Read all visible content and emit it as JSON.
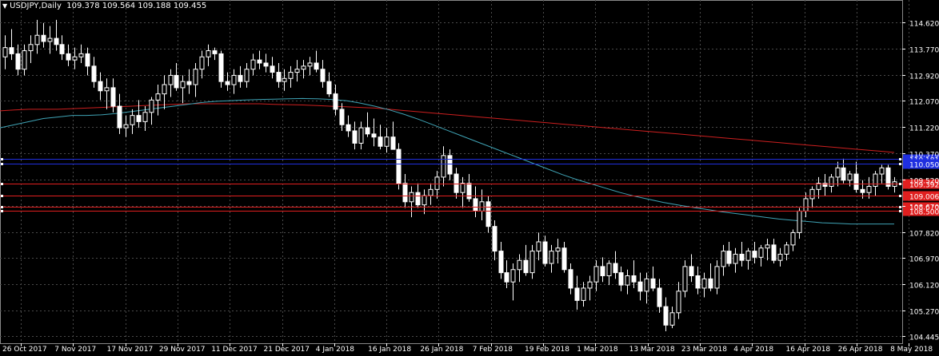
{
  "window": {
    "symbol_timeframe": "USDJPY,Daily",
    "ohlc": "109.378 109.564 109.188 109.455"
  },
  "colors": {
    "background": "#000000",
    "grid": "#4a4a4a",
    "bull_candle": "#000000",
    "bear_candle": "#ffffff",
    "wick": "#ffffff",
    "ma_slow": "#cc1f1f",
    "ma_fast": "#3fa3b5",
    "level_blue": "#1f2fe0",
    "level_red": "#e01f1f",
    "axis_text": "#ffffff"
  },
  "chart_data": {
    "type": "candlestick",
    "title": "",
    "ylim": [
      104.2,
      115.2
    ],
    "y_ticks": [
      "114.620",
      "113.770",
      "112.920",
      "112.070",
      "111.220",
      "110.370",
      "109.520",
      "108.670",
      "107.820",
      "106.970",
      "106.120",
      "105.270",
      "104.445"
    ],
    "x_ticks": [
      "26 Oct 2017",
      "7 Nov 2017",
      "17 Nov 2017",
      "29 Nov 2017",
      "11 Dec 2017",
      "21 Dec 2017",
      "4 Jan 2018",
      "16 Jan 2018",
      "26 Jan 2018",
      "7 Feb 2018",
      "19 Feb 2018",
      "1 Mar 2018",
      "13 Mar 2018",
      "23 Mar 2018",
      "4 Apr 2018",
      "16 Apr 2018",
      "26 Apr 2018",
      "8 May 2018"
    ],
    "levels": [
      {
        "color": "blue",
        "price": 110.181
      },
      {
        "color": "blue",
        "price": 110.05
      },
      {
        "color": "red",
        "price": 109.392
      },
      {
        "color": "red",
        "price": 109.006
      },
      {
        "color": "red",
        "price": 108.64
      },
      {
        "color": "red",
        "price": 108.5
      }
    ],
    "level_labels": [
      "110.181",
      "110.050",
      "109.392",
      "109.006",
      "108.640",
      "108.500"
    ],
    "candles": [
      [
        113.5,
        114.2,
        113.1,
        113.8
      ],
      [
        113.8,
        114.4,
        113.4,
        113.6
      ],
      [
        113.6,
        113.9,
        112.9,
        113.1
      ],
      [
        113.1,
        113.9,
        112.9,
        113.7
      ],
      [
        113.7,
        114.2,
        113.3,
        113.9
      ],
      [
        113.9,
        114.7,
        113.6,
        114.2
      ],
      [
        114.2,
        114.6,
        113.8,
        114.0
      ],
      [
        114.0,
        114.5,
        113.6,
        114.1
      ],
      [
        114.1,
        114.7,
        113.7,
        113.9
      ],
      [
        113.9,
        114.2,
        113.4,
        113.6
      ],
      [
        113.6,
        113.9,
        113.2,
        113.4
      ],
      [
        113.4,
        113.8,
        113.1,
        113.5
      ],
      [
        113.5,
        113.9,
        113.3,
        113.6
      ],
      [
        113.6,
        113.8,
        112.9,
        113.2
      ],
      [
        113.2,
        113.5,
        112.5,
        112.7
      ],
      [
        112.7,
        113.0,
        112.1,
        112.4
      ],
      [
        112.4,
        112.8,
        111.8,
        112.5
      ],
      [
        112.5,
        112.8,
        111.7,
        111.9
      ],
      [
        111.9,
        112.3,
        111.0,
        111.2
      ],
      [
        111.2,
        111.6,
        110.9,
        111.3
      ],
      [
        111.3,
        111.8,
        111.0,
        111.6
      ],
      [
        111.6,
        112.1,
        111.2,
        111.4
      ],
      [
        111.4,
        111.9,
        111.1,
        111.7
      ],
      [
        111.7,
        112.2,
        111.3,
        112.1
      ],
      [
        112.1,
        112.6,
        111.6,
        112.3
      ],
      [
        112.3,
        112.9,
        111.8,
        112.6
      ],
      [
        112.6,
        113.1,
        112.2,
        112.9
      ],
      [
        112.9,
        113.3,
        112.4,
        112.5
      ],
      [
        112.5,
        112.9,
        112.0,
        112.7
      ],
      [
        112.7,
        113.1,
        112.3,
        112.6
      ],
      [
        112.6,
        113.3,
        112.2,
        113.1
      ],
      [
        113.1,
        113.7,
        112.8,
        113.5
      ],
      [
        113.5,
        113.9,
        113.2,
        113.7
      ],
      [
        113.7,
        113.8,
        113.4,
        113.6
      ],
      [
        113.6,
        113.7,
        112.5,
        112.7
      ],
      [
        112.7,
        113.0,
        112.4,
        112.6
      ],
      [
        112.6,
        113.1,
        112.3,
        112.9
      ],
      [
        112.9,
        113.2,
        112.5,
        112.7
      ],
      [
        112.7,
        113.3,
        112.5,
        113.1
      ],
      [
        113.1,
        113.6,
        112.9,
        113.4
      ],
      [
        113.4,
        113.7,
        113.1,
        113.3
      ],
      [
        113.3,
        113.6,
        113.0,
        113.2
      ],
      [
        113.2,
        113.5,
        112.8,
        113.0
      ],
      [
        113.0,
        113.3,
        112.5,
        112.7
      ],
      [
        112.7,
        113.1,
        112.4,
        112.8
      ],
      [
        112.8,
        113.2,
        112.5,
        113.0
      ],
      [
        113.0,
        113.4,
        112.7,
        113.1
      ],
      [
        113.1,
        113.4,
        112.8,
        113.2
      ],
      [
        113.2,
        113.5,
        112.9,
        113.3
      ],
      [
        113.3,
        113.7,
        113.0,
        113.1
      ],
      [
        113.1,
        113.4,
        112.5,
        112.7
      ],
      [
        112.7,
        113.0,
        112.2,
        112.3
      ],
      [
        112.3,
        112.6,
        111.6,
        111.8
      ],
      [
        111.8,
        112.0,
        111.1,
        111.3
      ],
      [
        111.3,
        111.6,
        110.9,
        111.1
      ],
      [
        111.1,
        111.4,
        110.5,
        110.7
      ],
      [
        110.7,
        111.4,
        110.5,
        111.2
      ],
      [
        111.2,
        111.7,
        110.9,
        111.0
      ],
      [
        111.0,
        111.5,
        110.6,
        110.9
      ],
      [
        110.9,
        111.3,
        110.5,
        110.6
      ],
      [
        110.6,
        111.2,
        110.4,
        110.9
      ],
      [
        110.9,
        111.4,
        110.6,
        110.5
      ],
      [
        110.5,
        110.7,
        109.2,
        109.4
      ],
      [
        109.4,
        109.7,
        108.6,
        108.8
      ],
      [
        108.8,
        109.3,
        108.3,
        109.1
      ],
      [
        109.1,
        109.4,
        108.6,
        108.7
      ],
      [
        108.7,
        109.2,
        108.4,
        109.0
      ],
      [
        109.0,
        109.4,
        108.7,
        109.2
      ],
      [
        109.2,
        109.8,
        108.9,
        109.6
      ],
      [
        109.6,
        110.6,
        109.3,
        110.3
      ],
      [
        110.3,
        110.5,
        109.5,
        109.7
      ],
      [
        109.7,
        109.9,
        108.9,
        109.1
      ],
      [
        109.1,
        109.6,
        108.6,
        109.4
      ],
      [
        109.4,
        109.7,
        108.8,
        108.9
      ],
      [
        108.9,
        109.3,
        108.3,
        108.5
      ],
      [
        108.5,
        109.2,
        108.2,
        108.8
      ],
      [
        108.8,
        109.0,
        107.8,
        108.0
      ],
      [
        108.0,
        108.2,
        106.9,
        107.2
      ],
      [
        107.2,
        107.5,
        106.3,
        106.5
      ],
      [
        106.5,
        106.9,
        106.0,
        106.2
      ],
      [
        106.2,
        106.8,
        105.6,
        106.6
      ],
      [
        106.6,
        107.1,
        106.2,
        106.9
      ],
      [
        106.9,
        107.4,
        106.4,
        106.5
      ],
      [
        106.5,
        107.4,
        106.3,
        107.2
      ],
      [
        107.2,
        107.8,
        106.9,
        107.5
      ],
      [
        107.5,
        107.7,
        106.7,
        106.8
      ],
      [
        106.8,
        107.4,
        106.5,
        107.2
      ],
      [
        107.2,
        107.6,
        106.8,
        107.3
      ],
      [
        107.3,
        107.5,
        106.5,
        106.6
      ],
      [
        106.6,
        106.8,
        105.8,
        106.0
      ],
      [
        106.0,
        106.4,
        105.3,
        105.6
      ],
      [
        105.6,
        106.2,
        105.4,
        106.0
      ],
      [
        106.0,
        106.4,
        105.6,
        106.2
      ],
      [
        106.2,
        106.9,
        105.9,
        106.7
      ],
      [
        106.7,
        107.0,
        106.2,
        106.4
      ],
      [
        106.4,
        106.9,
        106.1,
        106.8
      ],
      [
        106.8,
        107.2,
        106.3,
        106.5
      ],
      [
        106.5,
        106.7,
        105.9,
        106.1
      ],
      [
        106.1,
        106.6,
        105.8,
        106.4
      ],
      [
        106.4,
        106.9,
        106.0,
        106.2
      ],
      [
        106.2,
        106.5,
        105.6,
        105.9
      ],
      [
        105.9,
        106.5,
        105.5,
        106.3
      ],
      [
        106.3,
        106.7,
        105.9,
        106.0
      ],
      [
        106.0,
        106.3,
        105.2,
        105.4
      ],
      [
        105.4,
        105.7,
        104.6,
        104.8
      ],
      [
        104.8,
        105.4,
        104.7,
        105.2
      ],
      [
        105.2,
        106.2,
        105.0,
        105.9
      ],
      [
        105.9,
        106.9,
        105.7,
        106.7
      ],
      [
        106.7,
        107.1,
        106.2,
        106.4
      ],
      [
        106.4,
        106.7,
        105.8,
        106.0
      ],
      [
        106.0,
        106.5,
        105.7,
        106.3
      ],
      [
        106.3,
        106.8,
        105.9,
        106.0
      ],
      [
        106.0,
        106.9,
        105.8,
        106.7
      ],
      [
        106.7,
        107.4,
        106.4,
        107.2
      ],
      [
        107.2,
        107.5,
        106.7,
        106.8
      ],
      [
        106.8,
        107.3,
        106.5,
        107.1
      ],
      [
        107.1,
        107.5,
        106.7,
        106.9
      ],
      [
        106.9,
        107.3,
        106.6,
        107.2
      ],
      [
        107.2,
        107.5,
        106.8,
        107.0
      ],
      [
        107.0,
        107.4,
        106.7,
        107.3
      ],
      [
        107.3,
        107.6,
        106.9,
        107.4
      ],
      [
        107.4,
        107.6,
        106.8,
        106.9
      ],
      [
        106.9,
        107.3,
        106.7,
        107.1
      ],
      [
        107.1,
        107.5,
        106.9,
        107.4
      ],
      [
        107.4,
        107.9,
        107.2,
        107.8
      ],
      [
        107.8,
        108.6,
        107.6,
        108.5
      ],
      [
        108.5,
        109.1,
        108.3,
        108.9
      ],
      [
        108.9,
        109.3,
        108.6,
        109.2
      ],
      [
        109.2,
        109.6,
        108.9,
        109.4
      ],
      [
        109.4,
        109.7,
        109.0,
        109.3
      ],
      [
        109.3,
        109.7,
        109.1,
        109.6
      ],
      [
        109.6,
        110.1,
        109.3,
        109.9
      ],
      [
        109.9,
        110.2,
        109.4,
        109.5
      ],
      [
        109.5,
        109.8,
        109.3,
        109.7
      ],
      [
        109.7,
        110.1,
        109.1,
        109.2
      ],
      [
        109.2,
        109.5,
        108.9,
        109.1
      ],
      [
        109.1,
        109.6,
        108.9,
        109.3
      ],
      [
        109.3,
        109.8,
        109.0,
        109.7
      ],
      [
        109.7,
        110.0,
        109.4,
        109.9
      ],
      [
        109.9,
        110.0,
        109.2,
        109.3
      ],
      [
        109.3,
        109.6,
        109.1,
        109.45
      ]
    ],
    "ma_slow": [
      111.75,
      111.78,
      111.8,
      111.8,
      111.8,
      111.82,
      111.84,
      111.86,
      111.88,
      111.9,
      111.92,
      111.94,
      111.96,
      111.98,
      111.98,
      111.98,
      111.98,
      111.98,
      111.98,
      111.96,
      111.95,
      111.94,
      111.92,
      111.9,
      111.88,
      111.86,
      111.84,
      111.8,
      111.76,
      111.72,
      111.68,
      111.64,
      111.6,
      111.56,
      111.52,
      111.48,
      111.44,
      111.4,
      111.36,
      111.32,
      111.28,
      111.24,
      111.2,
      111.16,
      111.12,
      111.08,
      111.04,
      111.0,
      110.96,
      110.92,
      110.88,
      110.84,
      110.8,
      110.76,
      110.72,
      110.68,
      110.64,
      110.6,
      110.56,
      110.52,
      110.48,
      110.44,
      110.4
    ],
    "ma_fast": [
      111.2,
      111.3,
      111.4,
      111.5,
      111.55,
      111.6,
      111.6,
      111.62,
      111.66,
      111.72,
      111.78,
      111.84,
      111.9,
      111.96,
      112.02,
      112.06,
      112.08,
      112.1,
      112.12,
      112.13,
      112.14,
      112.15,
      112.14,
      112.12,
      112.08,
      112.0,
      111.9,
      111.78,
      111.64,
      111.48,
      111.3,
      111.12,
      110.94,
      110.76,
      110.58,
      110.4,
      110.22,
      110.04,
      109.86,
      109.68,
      109.52,
      109.38,
      109.24,
      109.1,
      108.98,
      108.88,
      108.78,
      108.7,
      108.62,
      108.55,
      108.48,
      108.42,
      108.36,
      108.3,
      108.24,
      108.2,
      108.16,
      108.12,
      108.1,
      108.08,
      108.08,
      108.08,
      108.08
    ]
  }
}
